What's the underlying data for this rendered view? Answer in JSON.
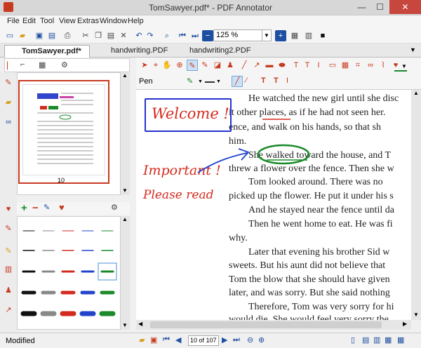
{
  "window": {
    "title": "TomSawyer.pdf* - PDF Annotator",
    "min": "—",
    "max": "☐",
    "close": "✕"
  },
  "menu": [
    "File",
    "Edit",
    "Tool",
    "View",
    "Extras",
    "Window",
    "Help"
  ],
  "toolbar": {
    "zoom": "125 %"
  },
  "tabs": [
    {
      "label": "TomSawyer.pdf*"
    },
    {
      "label": "handwriting.PDF"
    },
    {
      "label": "handwriting2.PDF"
    }
  ],
  "thumbnail": {
    "page_number": "10"
  },
  "prop_toolbar": {
    "pen_label": "Pen"
  },
  "document": {
    "lines": [
      "He watched the new girl until she disc",
      "it other places, as if he had not seen her.",
      "ence, and walk on his hands, so that sh",
      "him.",
      "She walked toward the house, and T",
      "threw a flower over the fence. Then she w",
      "Tom looked around. There was no",
      "picked up the flower. He put it under his s",
      "And he stayed near the fence until da",
      "Then he went home to eat. He was fi",
      "why.",
      "Later that evening his brother Sid w",
      "sweets. But his aunt did not believe that",
      "Tom the blow that she should have given",
      "later, and was sorry. But she said nothing",
      "Therefore, Tom was very sorry for hi",
      "would die. She would feel very sorry the"
    ]
  },
  "annotations": {
    "welcome": "Welcome !",
    "important": "Important !",
    "please": "Please read"
  },
  "statusbar": {
    "status": "Modified",
    "page": "10 of 107"
  },
  "colors": {
    "accent": "#1e4fa0",
    "red_ink": "#d42a1e",
    "blue_ink": "#2244cc",
    "green_ink": "#1a8a2a"
  }
}
